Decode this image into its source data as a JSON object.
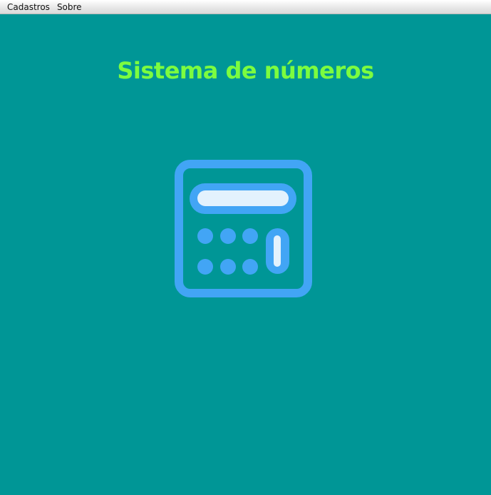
{
  "menubar": {
    "items": [
      {
        "label": "Cadastros"
      },
      {
        "label": "Sobre"
      }
    ]
  },
  "main": {
    "title": "Sistema de números",
    "title_color": "#7CFC3F",
    "background_color": "#009696",
    "icon": "calculator-icon",
    "icon_color": "#42A5F5",
    "icon_highlight_color": "#E3F2FD"
  }
}
